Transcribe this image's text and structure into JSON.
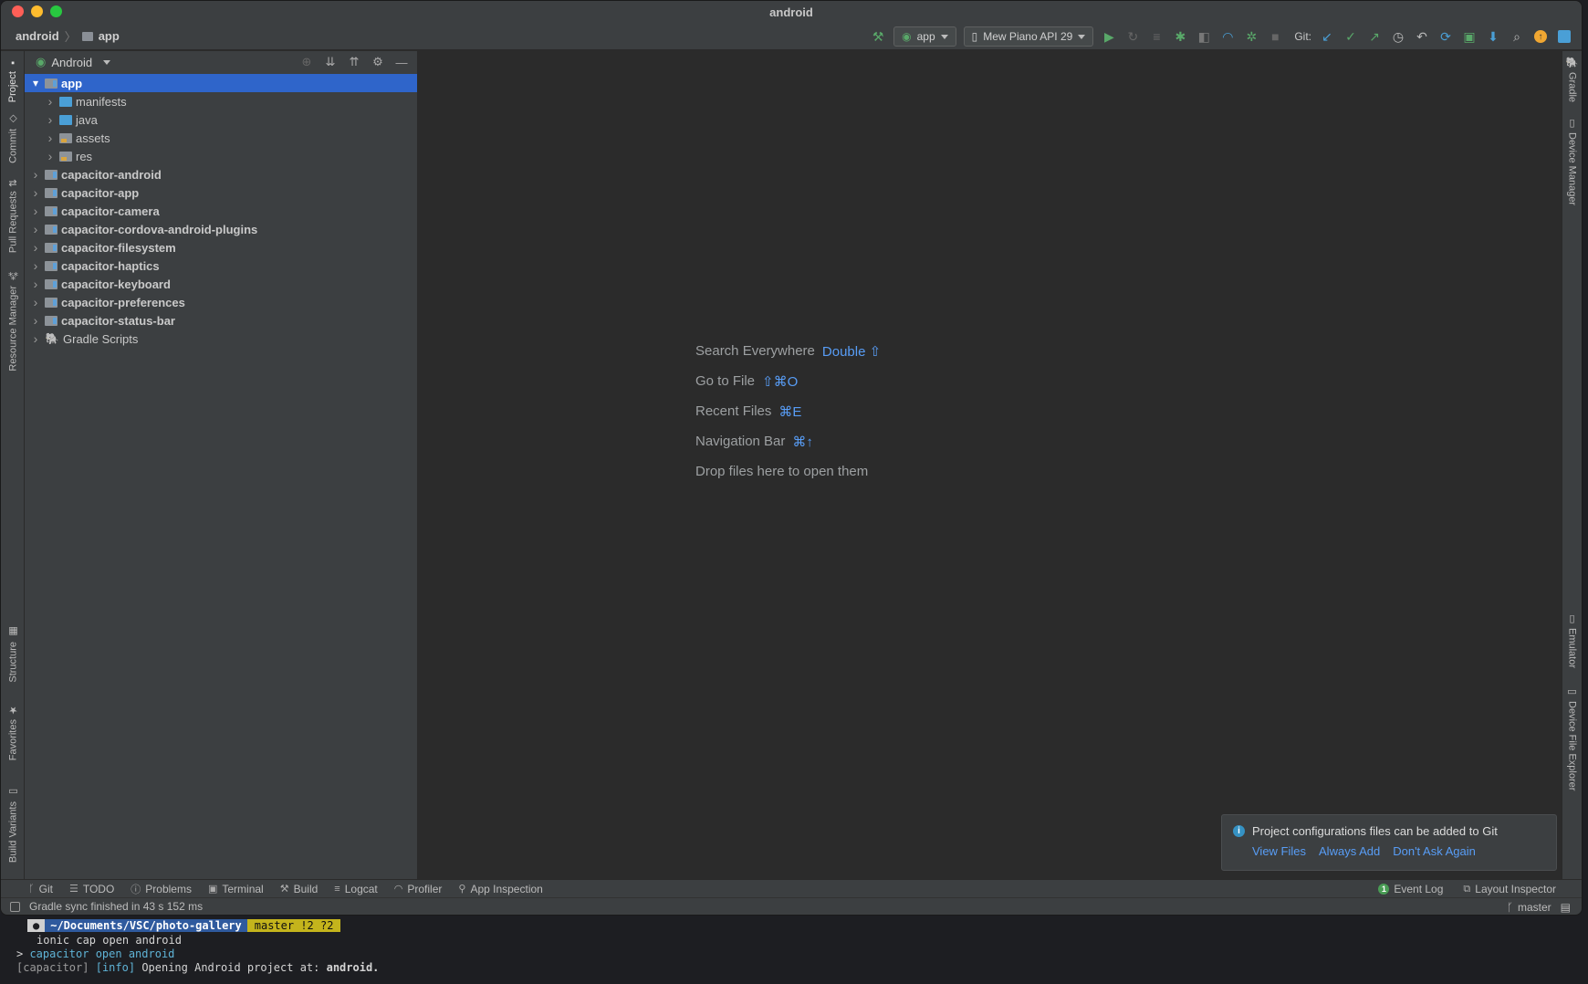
{
  "window": {
    "title": "android"
  },
  "toolbar": {
    "breadcrumb": [
      "android",
      "app"
    ],
    "run_config": "app",
    "device": "Mew Piano API 29",
    "git_label": "Git:"
  },
  "left_stripe": [
    "Project",
    "Commit",
    "Pull Requests",
    "Resource Manager",
    "Structure",
    "Favorites",
    "Build Variants"
  ],
  "right_stripe": [
    "Gradle",
    "Device Manager",
    "Emulator",
    "Device File Explorer"
  ],
  "project_panel": {
    "view_name": "Android",
    "tree": [
      {
        "label": "app",
        "depth": 0,
        "icon": "module",
        "bold": true,
        "selected": true,
        "expanded": true
      },
      {
        "label": "manifests",
        "depth": 1,
        "icon": "folder-blue"
      },
      {
        "label": "java",
        "depth": 1,
        "icon": "folder-blue"
      },
      {
        "label": "assets",
        "depth": 1,
        "icon": "folder-res"
      },
      {
        "label": "res",
        "depth": 1,
        "icon": "folder-res"
      },
      {
        "label": "capacitor-android",
        "depth": 0,
        "icon": "module",
        "bold": true
      },
      {
        "label": "capacitor-app",
        "depth": 0,
        "icon": "module",
        "bold": true
      },
      {
        "label": "capacitor-camera",
        "depth": 0,
        "icon": "module",
        "bold": true
      },
      {
        "label": "capacitor-cordova-android-plugins",
        "depth": 0,
        "icon": "module",
        "bold": true
      },
      {
        "label": "capacitor-filesystem",
        "depth": 0,
        "icon": "module",
        "bold": true
      },
      {
        "label": "capacitor-haptics",
        "depth": 0,
        "icon": "module",
        "bold": true
      },
      {
        "label": "capacitor-keyboard",
        "depth": 0,
        "icon": "module",
        "bold": true
      },
      {
        "label": "capacitor-preferences",
        "depth": 0,
        "icon": "module",
        "bold": true
      },
      {
        "label": "capacitor-status-bar",
        "depth": 0,
        "icon": "module",
        "bold": true
      },
      {
        "label": "Gradle Scripts",
        "depth": 0,
        "icon": "gradle",
        "bold": false
      }
    ]
  },
  "editor_hints": [
    {
      "label": "Search Everywhere",
      "key": "Double ⇧"
    },
    {
      "label": "Go to File",
      "key": "⇧⌘O"
    },
    {
      "label": "Recent Files",
      "key": "⌘E"
    },
    {
      "label": "Navigation Bar",
      "key": "⌘↑"
    },
    {
      "label": "Drop files here to open them",
      "key": ""
    }
  ],
  "notification": {
    "message": "Project configurations files can be added to Git",
    "actions": [
      "View Files",
      "Always Add",
      "Don't Ask Again"
    ]
  },
  "bottom_tools": [
    "Git",
    "TODO",
    "Problems",
    "Terminal",
    "Build",
    "Logcat",
    "Profiler",
    "App Inspection"
  ],
  "bottom_tools_right": {
    "event_log": "Event Log",
    "event_count": "1",
    "layout_inspector": "Layout Inspector"
  },
  "status": {
    "message": "Gradle sync finished in 43 s 152 ms",
    "branch": "master"
  },
  "terminal": {
    "path": "~/Documents/VSC/photo-gallery",
    "git": "master !2 ?2",
    "command": "ionic cap open android",
    "line2_prefix": "> ",
    "line2_cmd": "capacitor open android",
    "line3_tag": "[capacitor]",
    "line3_info": "[info]",
    "line3_text": "Opening Android project at: ",
    "line3_bold": "android."
  },
  "colors": {
    "accent": "#2f65ca",
    "link": "#589df6",
    "run_green": "#59a869"
  }
}
